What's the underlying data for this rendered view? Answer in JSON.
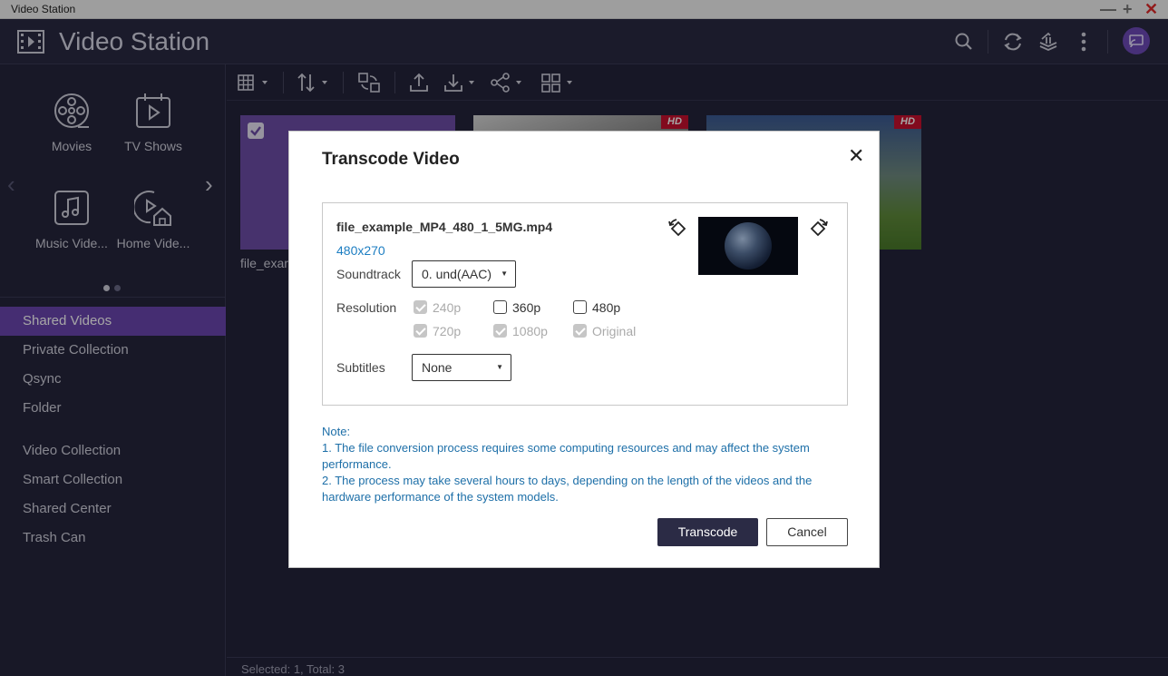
{
  "window": {
    "title": "Video Station",
    "controls": {
      "minimize": "—",
      "maximize": "+",
      "close": "✕"
    }
  },
  "header": {
    "app_title": "Video Station",
    "icons": [
      "search-icon",
      "refresh-icon",
      "tasks-icon",
      "more-icon",
      "cast-icon"
    ]
  },
  "sidebar": {
    "categories": [
      {
        "label": "Movies",
        "icon": "film-reel-icon"
      },
      {
        "label": "TV Shows",
        "icon": "tv-play-icon"
      },
      {
        "label": "Music Vide...",
        "icon": "music-video-icon"
      },
      {
        "label": "Home Vide...",
        "icon": "home-video-icon"
      }
    ],
    "nav_prev": "‹",
    "nav_next": "›",
    "items": [
      {
        "label": "Shared Videos",
        "active": true
      },
      {
        "label": "Private Collection"
      },
      {
        "label": "Qsync"
      },
      {
        "label": "Folder"
      },
      {
        "label": "Video Collection"
      },
      {
        "label": "Smart Collection"
      },
      {
        "label": "Shared Center"
      },
      {
        "label": "Trash Can"
      }
    ]
  },
  "toolbar": {
    "icons": [
      "grid-view-icon",
      "sort-icon",
      "convert-icon",
      "upload-icon",
      "download-icon",
      "share-icon",
      "multi-select-icon"
    ]
  },
  "content": {
    "thumbnails": [
      {
        "label": "file_exar",
        "selected": true,
        "hd": false
      },
      {
        "label": "",
        "selected": false,
        "hd": true,
        "hd_text": "HD"
      },
      {
        "label": "",
        "selected": false,
        "hd": true,
        "hd_text": "HD"
      }
    ],
    "status": "Selected: 1, Total: 3"
  },
  "dialog": {
    "title": "Transcode Video",
    "close": "✕",
    "file_name": "file_example_MP4_480_1_5MG.mp4",
    "file_resolution": "480x270",
    "soundtrack": {
      "label": "Soundtrack",
      "value": "0. und(AAC)"
    },
    "resolution": {
      "label": "Resolution",
      "options": [
        {
          "label": "240p",
          "checked": true,
          "disabled": true
        },
        {
          "label": "360p",
          "checked": false,
          "disabled": false
        },
        {
          "label": "480p",
          "checked": false,
          "disabled": false
        },
        {
          "label": "720p",
          "checked": true,
          "disabled": true
        },
        {
          "label": "1080p",
          "checked": true,
          "disabled": true
        },
        {
          "label": "Original",
          "checked": true,
          "disabled": true
        }
      ]
    },
    "subtitles": {
      "label": "Subtitles",
      "value": "None"
    },
    "note": {
      "title": "Note:",
      "line1": "1. The file conversion process requires some computing resources and may affect the system performance.",
      "line2": "2. The process may take several hours to days, depending on the length of the videos and the hardware performance of the system models."
    },
    "buttons": {
      "primary": "Transcode",
      "secondary": "Cancel"
    }
  },
  "colors": {
    "accent": "#6b45b0",
    "link": "#1d7ec2",
    "hd_badge": "#c8102e",
    "dark_bg": "#24243b"
  }
}
